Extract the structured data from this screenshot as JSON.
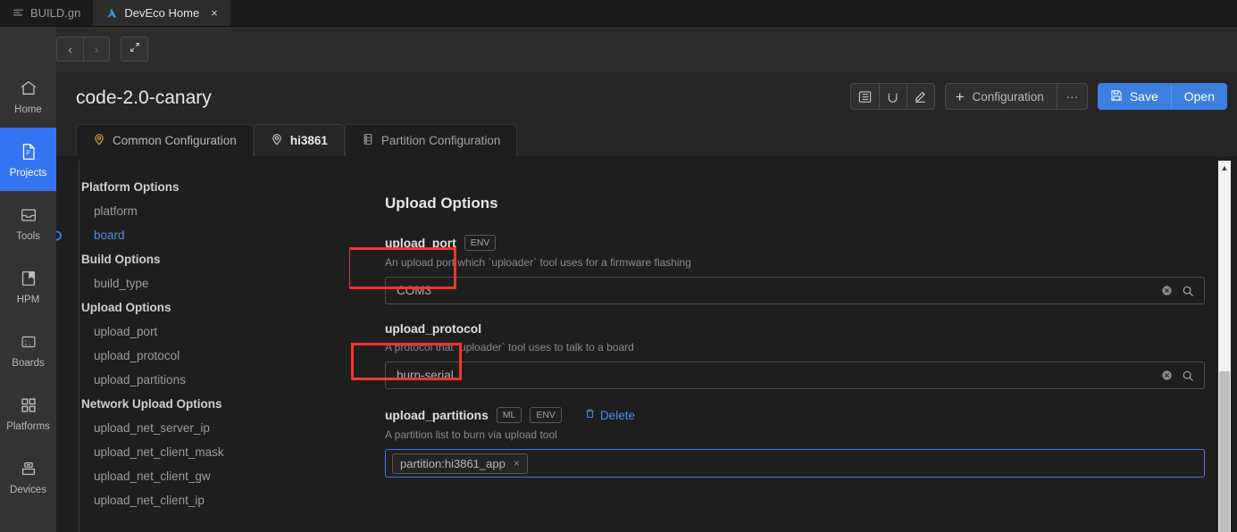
{
  "window_tabs": [
    {
      "label": "BUILD.gn",
      "icon": "file-lines-icon",
      "active": false,
      "closable": false
    },
    {
      "label": "DevEco Home",
      "icon": "deveco-logo-icon",
      "active": true,
      "closable": true,
      "close_label": "×"
    }
  ],
  "toolbar": {
    "logo_icon": "deveco-logo-icon",
    "back_label": "‹",
    "forward_label": "›",
    "expand_label": "expand-icon"
  },
  "rail": {
    "items": [
      {
        "label": "Home",
        "icon": "home-icon",
        "active": false
      },
      {
        "label": "Projects",
        "icon": "project-file-icon",
        "active": true
      },
      {
        "label": "Tools",
        "icon": "tools-tray-icon",
        "active": false
      },
      {
        "label": "HPM",
        "icon": "bookmark-book-icon",
        "active": false
      },
      {
        "label": "Boards",
        "icon": "calculator-icon",
        "active": false
      },
      {
        "label": "Platforms",
        "icon": "grid-squares-icon",
        "active": false
      },
      {
        "label": "Devices",
        "icon": "usb-device-icon",
        "active": false
      }
    ]
  },
  "header": {
    "title": "code-2.0-canary",
    "icon_buttons": [
      {
        "name": "list-view-icon",
        "glyph": "list"
      },
      {
        "name": "refresh-icon",
        "glyph": "refresh"
      },
      {
        "name": "edit-pencil-icon",
        "glyph": "pencil"
      }
    ],
    "configuration_label": "Configuration",
    "configuration_plus": "+",
    "more_label": "···",
    "save_label": "Save",
    "open_label": "Open"
  },
  "config_tabs": [
    {
      "label": "Common Configuration",
      "icon": "location-pin-icon",
      "selected": false
    },
    {
      "label": "hi3861",
      "icon": "location-pin-outline-icon",
      "selected": true
    },
    {
      "label": "Partition Configuration",
      "icon": "server-rack-icon",
      "selected": false
    }
  ],
  "tree": [
    {
      "type": "group",
      "label": "Platform Options"
    },
    {
      "type": "leaf",
      "label": "platform",
      "selected": false
    },
    {
      "type": "leaf",
      "label": "board",
      "selected": true
    },
    {
      "type": "group",
      "label": "Build Options"
    },
    {
      "type": "leaf",
      "label": "build_type",
      "selected": false
    },
    {
      "type": "group",
      "label": "Upload Options"
    },
    {
      "type": "leaf",
      "label": "upload_port",
      "selected": false
    },
    {
      "type": "leaf",
      "label": "upload_protocol",
      "selected": false
    },
    {
      "type": "leaf",
      "label": "upload_partitions",
      "selected": false
    },
    {
      "type": "group",
      "label": "Network Upload Options"
    },
    {
      "type": "leaf",
      "label": "upload_net_server_ip",
      "selected": false
    },
    {
      "type": "leaf",
      "label": "upload_net_client_mask",
      "selected": false
    },
    {
      "type": "leaf",
      "label": "upload_net_client_gw",
      "selected": false
    },
    {
      "type": "leaf",
      "label": "upload_net_client_ip",
      "selected": false
    }
  ],
  "content": {
    "section_title": "Upload Options",
    "fields": [
      {
        "name": "upload_port",
        "badges": [
          "ENV"
        ],
        "description": "An upload port which `uploader` tool uses for a firmware flashing",
        "value": "COM3",
        "clear_icon": "clear-circle-icon",
        "search_icon": "search-icon",
        "highlighted": true
      },
      {
        "name": "upload_protocol",
        "badges": [],
        "description": "A protocol that `uploader` tool uses to talk to a board",
        "value": "burn-serial",
        "clear_icon": "clear-circle-icon",
        "search_icon": "search-icon",
        "highlighted": true
      },
      {
        "name": "upload_partitions",
        "badges": [
          "ML",
          "ENV"
        ],
        "delete_label": "Delete",
        "delete_icon": "trash-icon",
        "description": "A partition list to burn via upload tool",
        "tags": [
          {
            "label": "partition:hi3861_app",
            "remove_label": "×"
          }
        ]
      }
    ]
  },
  "scrollbar": {
    "up_arrow": "▲",
    "name": "vertical-scrollbar"
  },
  "colors": {
    "accent_blue": "#3574f0",
    "link_blue": "#4a90e8",
    "highlight_red": "#f4352f",
    "tab_yellow": "#e8a33d",
    "bg": "#1e1e1e",
    "panel": "#262626",
    "rail": "#333333"
  }
}
